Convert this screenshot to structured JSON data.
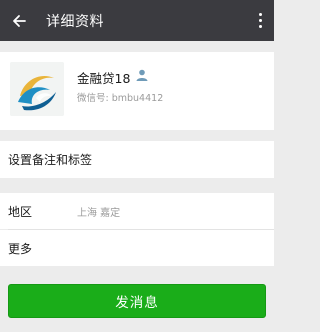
{
  "header": {
    "title": "详细资料",
    "back_icon": "arrow-left-icon",
    "more_icon": "more-vertical-icon"
  },
  "profile": {
    "name": "金融贷18",
    "wechat_id": "微信号: bmbu4412",
    "avatar_icon": "wave-logo-icon",
    "gender_icon": "person-icon"
  },
  "rows": {
    "remark_label": "设置备注和标签",
    "region_label": "地区",
    "region_value": "上海  嘉定",
    "more_label": "更多"
  },
  "actions": {
    "send_message_label": "发消息"
  },
  "colors": {
    "topbar": "#3b3b40",
    "background": "#ececec",
    "accent_green": "#1aad19",
    "secondary_text": "#9b9b9b",
    "gender_icon": "#6f9bb8"
  }
}
